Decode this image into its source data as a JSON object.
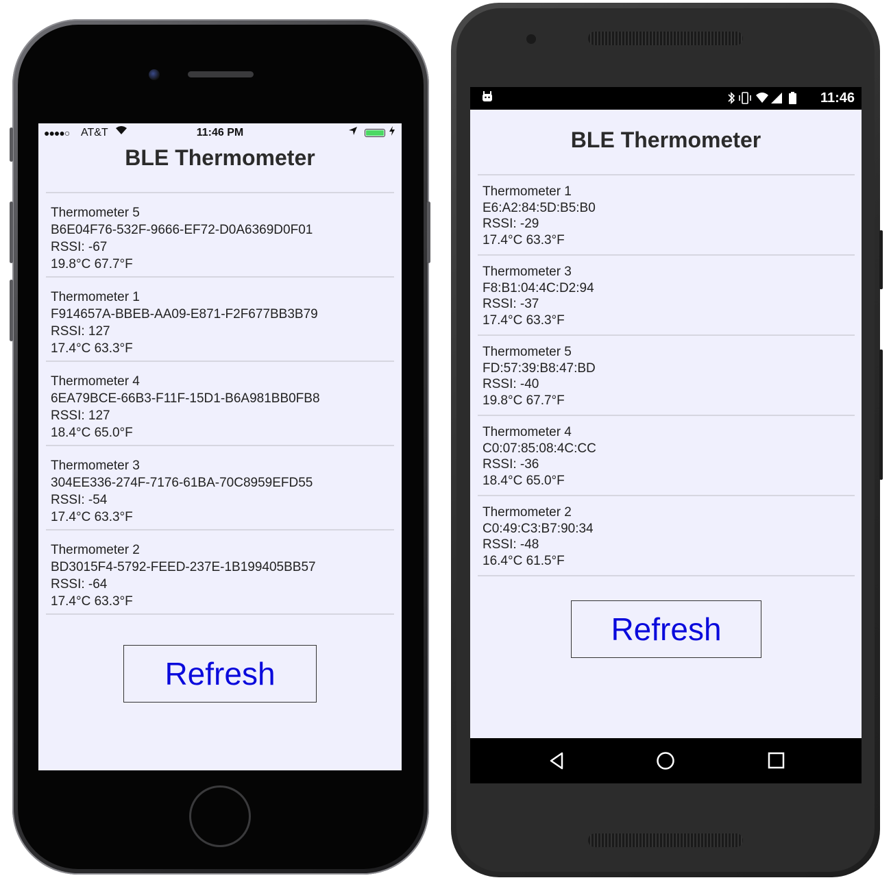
{
  "ios": {
    "status": {
      "signal": "●●●●○",
      "carrier": "AT&T",
      "time": "11:46 PM",
      "battery_color": "#4cd964"
    },
    "title": "BLE Thermometer",
    "devices": [
      {
        "name": "Thermometer 5",
        "id": "B6E04F76-532F-9666-EF72-D0A6369D0F01",
        "rssi": "RSSI: -67",
        "temp": "19.8°C 67.7°F"
      },
      {
        "name": "Thermometer 1",
        "id": "F914657A-BBEB-AA09-E871-F2F677BB3B79",
        "rssi": "RSSI: 127",
        "temp": "17.4°C 63.3°F"
      },
      {
        "name": "Thermometer 4",
        "id": "6EA79BCE-66B3-F11F-15D1-B6A981BB0FB8",
        "rssi": "RSSI: 127",
        "temp": "18.4°C 65.0°F"
      },
      {
        "name": "Thermometer 3",
        "id": "304EE336-274F-7176-61BA-70C8959EFD55",
        "rssi": "RSSI: -54",
        "temp": "17.4°C 63.3°F"
      },
      {
        "name": "Thermometer 2",
        "id": "BD3015F4-5792-FEED-237E-1B199405BB57",
        "rssi": "RSSI: -64",
        "temp": "17.4°C 63.3°F"
      }
    ],
    "refresh_label": "Refresh"
  },
  "android": {
    "status": {
      "time": "11:46"
    },
    "title": "BLE Thermometer",
    "devices": [
      {
        "name": "Thermometer 1",
        "id": "E6:A2:84:5D:B5:B0",
        "rssi": "RSSI: -29",
        "temp": "17.4°C 63.3°F"
      },
      {
        "name": "Thermometer 3",
        "id": "F8:B1:04:4C:D2:94",
        "rssi": "RSSI: -37",
        "temp": "17.4°C 63.3°F"
      },
      {
        "name": "Thermometer 5",
        "id": "FD:57:39:B8:47:BD",
        "rssi": "RSSI: -40",
        "temp": "19.8°C 67.7°F"
      },
      {
        "name": "Thermometer 4",
        "id": "C0:07:85:08:4C:CC",
        "rssi": "RSSI: -36",
        "temp": "18.4°C 65.0°F"
      },
      {
        "name": "Thermometer 2",
        "id": "C0:49:C3:B7:90:34",
        "rssi": "RSSI: -48",
        "temp": "16.4°C 61.5°F"
      }
    ],
    "refresh_label": "Refresh"
  },
  "theme": {
    "screen_bg": "#f0f0fd",
    "button_text": "#0a0adc",
    "divider": "#d6d6e0"
  }
}
